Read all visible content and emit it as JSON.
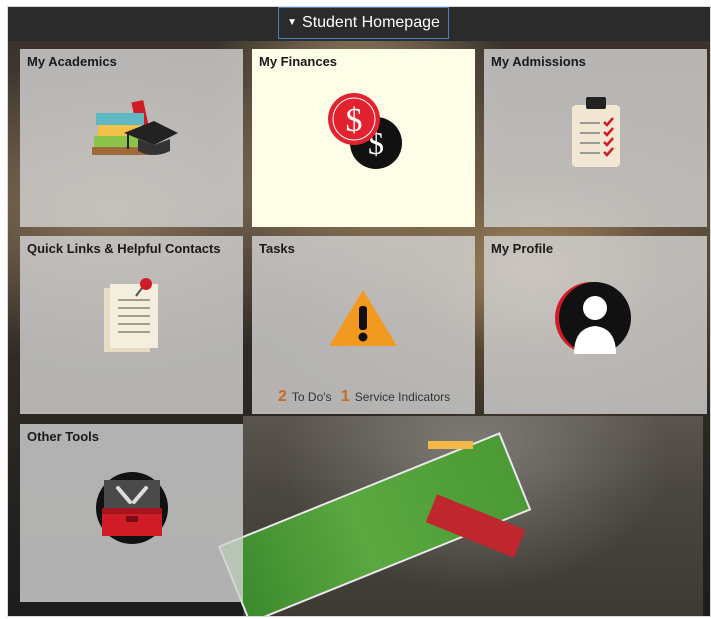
{
  "header": {
    "title": "Student Homepage"
  },
  "tiles": [
    {
      "title": "My Academics",
      "icon": "books-graduation-cap-icon"
    },
    {
      "title": "My Finances",
      "icon": "dollar-coins-icon"
    },
    {
      "title": "My Admissions",
      "icon": "clipboard-checklist-icon"
    },
    {
      "title": "Quick Links & Helpful Contacts",
      "icon": "pinned-document-icon"
    },
    {
      "title": "Tasks",
      "icon": "warning-icon",
      "counts": [
        {
          "value": "2",
          "label": "To Do's"
        },
        {
          "value": "1",
          "label": "Service Indicators"
        }
      ]
    },
    {
      "title": "My Profile",
      "icon": "user-avatar-icon"
    },
    {
      "title": "Other Tools",
      "icon": "toolbox-icon"
    }
  ],
  "colors": {
    "accent_red": "#d01c27",
    "task_count": "#c86a21",
    "warning": "#f29a1f"
  }
}
